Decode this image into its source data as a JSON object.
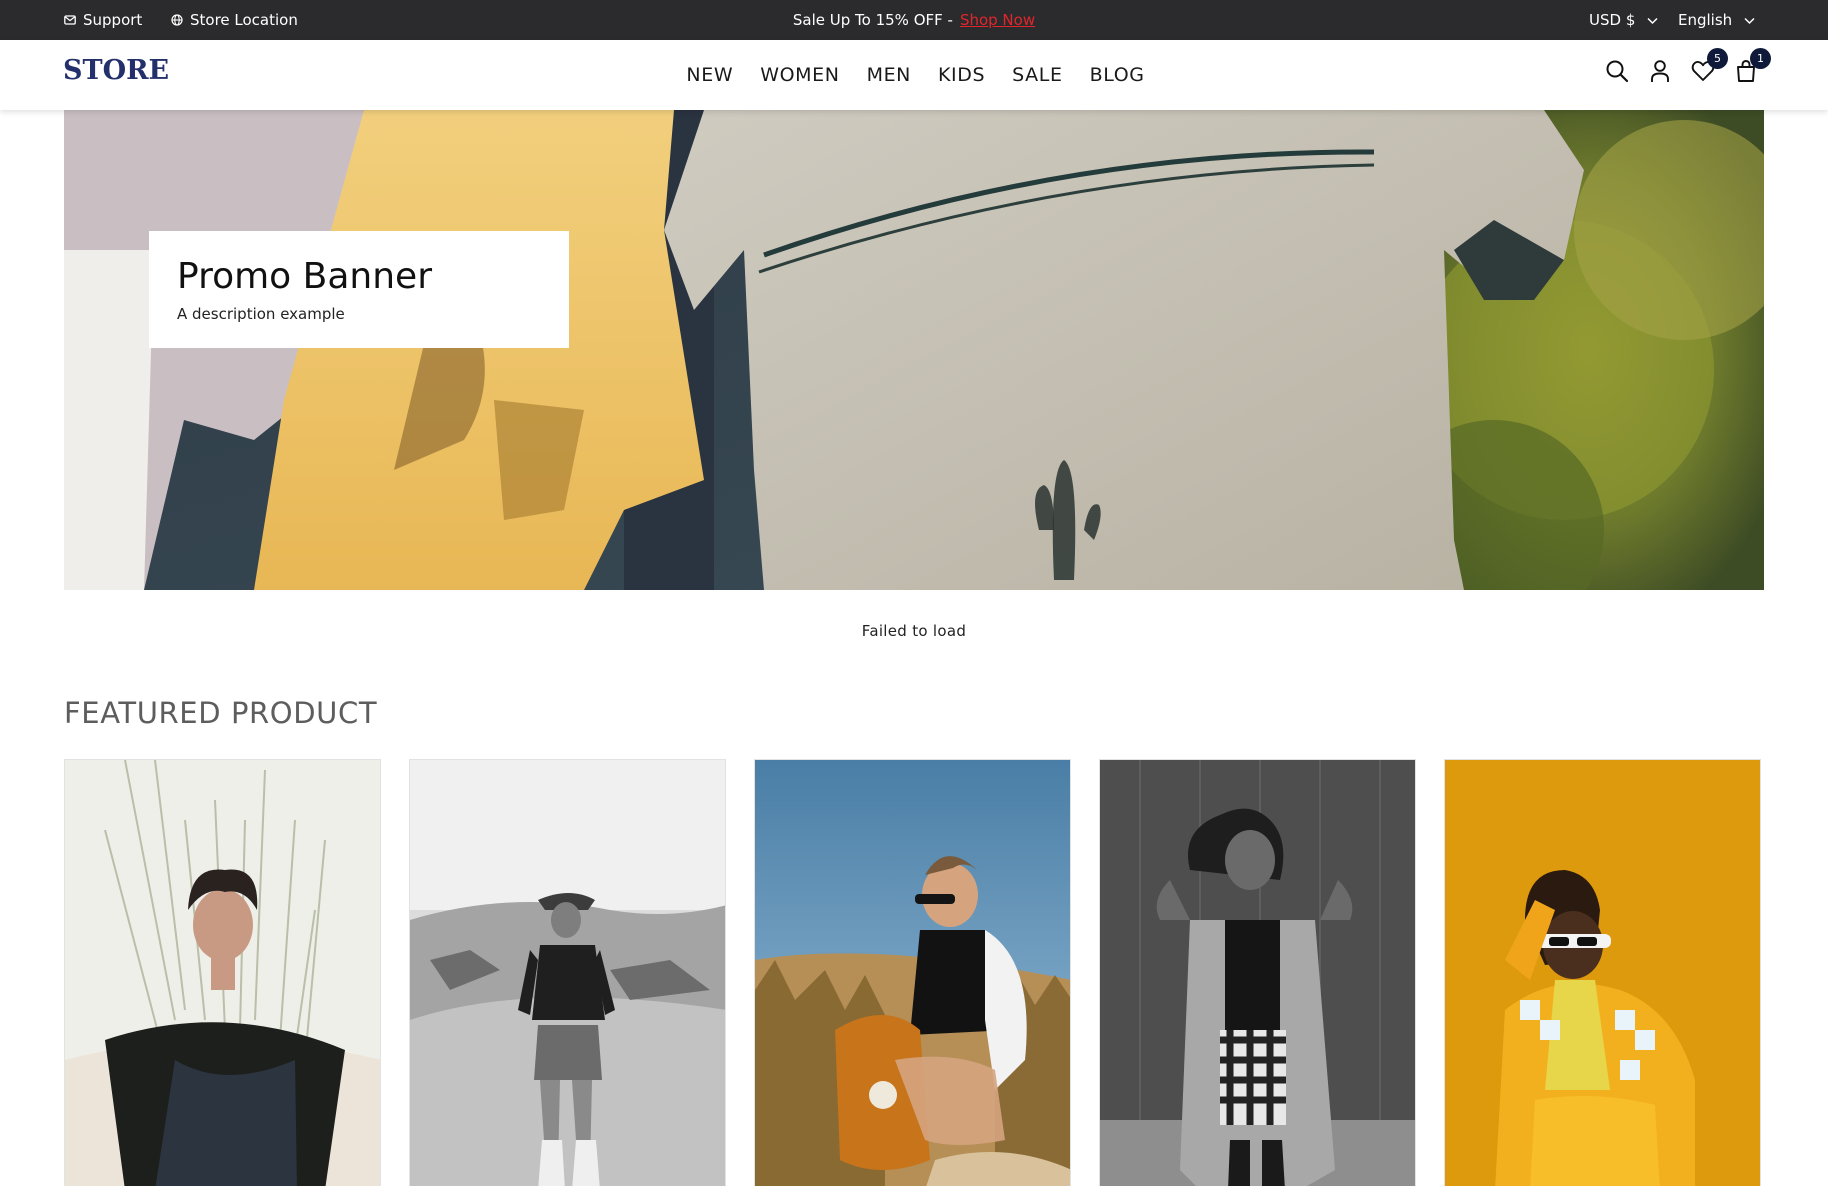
{
  "topbar": {
    "support_label": "Support",
    "store_location_label": "Store Location",
    "promo_text": "Sale Up To 15% OFF -",
    "promo_link": "Shop Now",
    "currency": "USD $",
    "language": "English"
  },
  "header": {
    "logo": "STORE",
    "nav": [
      "NEW",
      "WOMEN",
      "MEN",
      "KIDS",
      "SALE",
      "BLOG"
    ],
    "wishlist_count": "5",
    "cart_count": "1"
  },
  "hero": {
    "title": "Promo Banner",
    "description": "A description example"
  },
  "status_message": "Failed to load",
  "featured": {
    "title": "FEATURED PRODUCT"
  },
  "colors": {
    "topbar_bg": "#2b2b2d",
    "promo_link": "#e0262b",
    "logo": "#23306b",
    "badge": "#0f1a3a"
  },
  "icons": [
    "mail-icon",
    "globe-icon",
    "chevron-down-icon",
    "search-icon",
    "user-icon",
    "heart-icon",
    "bag-icon"
  ]
}
